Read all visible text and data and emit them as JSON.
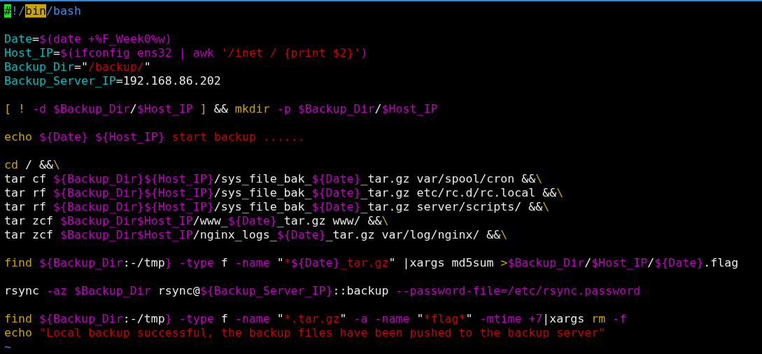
{
  "editor": {
    "blocks": [
      {
        "lines": [
          {
            "segments": [
              {
                "kind": "cursor",
                "text": "#"
              },
              {
                "kind": "path",
                "text": "!/"
              },
              {
                "kind": "search",
                "text": "bin"
              },
              {
                "kind": "path",
                "text": "/bash"
              }
            ]
          }
        ]
      },
      {
        "lines": [
          {
            "segments": [
              {
                "kind": "name",
                "text": "Date"
              },
              {
                "kind": "plain",
                "text": "="
              },
              {
                "kind": "variable",
                "text": "$(date +%F_Week0%w)"
              }
            ]
          },
          {
            "segments": [
              {
                "kind": "name",
                "text": "Host_IP"
              },
              {
                "kind": "plain",
                "text": "="
              },
              {
                "kind": "variable",
                "text": "$(ifconfig ens32 | awk "
              },
              {
                "kind": "string",
                "text": "'/inet / {print $2}'"
              },
              {
                "kind": "variable",
                "text": ")"
              }
            ]
          },
          {
            "segments": [
              {
                "kind": "name",
                "text": "Backup_Dir"
              },
              {
                "kind": "plain",
                "text": "=\""
              },
              {
                "kind": "string",
                "text": "/backup/"
              },
              {
                "kind": "plain",
                "text": "\""
              }
            ]
          },
          {
            "segments": [
              {
                "kind": "name",
                "text": "Backup_Server_IP"
              },
              {
                "kind": "plain",
                "text": "=192.168.86.202"
              }
            ]
          }
        ]
      },
      {
        "lines": [
          {
            "segments": [
              {
                "kind": "keyword",
                "text": "[ ! "
              },
              {
                "kind": "variable",
                "text": "-d $Backup_Dir"
              },
              {
                "kind": "plain",
                "text": "/"
              },
              {
                "kind": "variable",
                "text": "$Host_IP"
              },
              {
                "kind": "keyword",
                "text": " ]"
              },
              {
                "kind": "plain",
                "text": " && "
              },
              {
                "kind": "keyword",
                "text": "mkdir "
              },
              {
                "kind": "variable",
                "text": "-p $Backup_Dir"
              },
              {
                "kind": "plain",
                "text": "/"
              },
              {
                "kind": "variable",
                "text": "$Host_IP"
              }
            ]
          }
        ]
      },
      {
        "lines": [
          {
            "segments": [
              {
                "kind": "keyword",
                "text": "echo "
              },
              {
                "kind": "variable",
                "text": "${Date} ${Host_IP}"
              },
              {
                "kind": "string",
                "text": " start backup ......"
              }
            ]
          }
        ]
      },
      {
        "lines": [
          {
            "segments": [
              {
                "kind": "keyword",
                "text": "cd"
              },
              {
                "kind": "plain",
                "text": " / &&"
              },
              {
                "kind": "keyword",
                "text": "\\"
              }
            ]
          },
          {
            "segments": [
              {
                "kind": "plain",
                "text": "tar cf "
              },
              {
                "kind": "variable",
                "text": "${Backup_Dir}${Host_IP}"
              },
              {
                "kind": "plain",
                "text": "/sys_file_bak_"
              },
              {
                "kind": "variable",
                "text": "${Date}"
              },
              {
                "kind": "plain",
                "text": "_tar.gz var/spool/cron &&"
              },
              {
                "kind": "keyword",
                "text": "\\"
              }
            ]
          },
          {
            "segments": [
              {
                "kind": "plain",
                "text": "tar rf "
              },
              {
                "kind": "variable",
                "text": "${Backup_Dir}${Host_IP}"
              },
              {
                "kind": "plain",
                "text": "/sys_file_bak_"
              },
              {
                "kind": "variable",
                "text": "${Date}"
              },
              {
                "kind": "plain",
                "text": "_tar.gz etc/rc.d/rc.local &&"
              },
              {
                "kind": "keyword",
                "text": "\\"
              }
            ]
          },
          {
            "segments": [
              {
                "kind": "plain",
                "text": "tar rf "
              },
              {
                "kind": "variable",
                "text": "${Backup_Dir}${Host_IP}"
              },
              {
                "kind": "plain",
                "text": "/sys_file_bak_"
              },
              {
                "kind": "variable",
                "text": "${Date}"
              },
              {
                "kind": "plain",
                "text": "_tar.gz server/scripts/ &&"
              },
              {
                "kind": "keyword",
                "text": "\\"
              }
            ]
          },
          {
            "segments": [
              {
                "kind": "plain",
                "text": "tar zcf "
              },
              {
                "kind": "variable",
                "text": "$Backup_Dir$Host_IP"
              },
              {
                "kind": "plain",
                "text": "/www_"
              },
              {
                "kind": "variable",
                "text": "${Date}"
              },
              {
                "kind": "plain",
                "text": "_tar.gz www/ &&"
              },
              {
                "kind": "keyword",
                "text": "\\"
              }
            ]
          },
          {
            "segments": [
              {
                "kind": "plain",
                "text": "tar zcf "
              },
              {
                "kind": "variable",
                "text": "$Backup_Dir$Host_IP"
              },
              {
                "kind": "plain",
                "text": "/nginx_logs_"
              },
              {
                "kind": "variable",
                "text": "${Date}"
              },
              {
                "kind": "plain",
                "text": "_tar.gz var/log/nginx/ &&"
              },
              {
                "kind": "keyword",
                "text": "\\"
              }
            ]
          }
        ]
      },
      {
        "lines": [
          {
            "segments": [
              {
                "kind": "keyword",
                "text": "find "
              },
              {
                "kind": "variable",
                "text": "${Backup_Dir"
              },
              {
                "kind": "plain",
                "text": ":-/tmp"
              },
              {
                "kind": "variable",
                "text": "} -type"
              },
              {
                "kind": "plain",
                "text": " f "
              },
              {
                "kind": "variable",
                "text": "-name"
              },
              {
                "kind": "plain",
                "text": " \""
              },
              {
                "kind": "string",
                "text": "*"
              },
              {
                "kind": "variable",
                "text": "${Date}"
              },
              {
                "kind": "string",
                "text": "_tar.gz"
              },
              {
                "kind": "plain",
                "text": "\" |xargs md5sum "
              },
              {
                "kind": "keyword",
                "text": ">"
              },
              {
                "kind": "variable",
                "text": "$Backup_Dir"
              },
              {
                "kind": "plain",
                "text": "/"
              },
              {
                "kind": "variable",
                "text": "$Host_IP"
              },
              {
                "kind": "plain",
                "text": "/"
              },
              {
                "kind": "variable",
                "text": "${Date}"
              },
              {
                "kind": "plain",
                "text": ".flag"
              }
            ]
          }
        ]
      },
      {
        "lines": [
          {
            "segments": [
              {
                "kind": "plain",
                "text": "rsync "
              },
              {
                "kind": "variable",
                "text": "-az $Backup_Dir"
              },
              {
                "kind": "plain",
                "text": " rsync@"
              },
              {
                "kind": "variable",
                "text": "${Backup_Server_IP}"
              },
              {
                "kind": "plain",
                "text": "::backup "
              },
              {
                "kind": "variable",
                "text": "--password-file=/etc/rsync.password"
              }
            ]
          }
        ]
      },
      {
        "lines": [
          {
            "segments": [
              {
                "kind": "keyword",
                "text": "find "
              },
              {
                "kind": "variable",
                "text": "${Backup_Dir"
              },
              {
                "kind": "plain",
                "text": ":-/tmp"
              },
              {
                "kind": "variable",
                "text": "} -type"
              },
              {
                "kind": "plain",
                "text": " f "
              },
              {
                "kind": "variable",
                "text": "-name"
              },
              {
                "kind": "plain",
                "text": " \""
              },
              {
                "kind": "string",
                "text": "*.tar.gz"
              },
              {
                "kind": "plain",
                "text": "\" "
              },
              {
                "kind": "variable",
                "text": "-a -name"
              },
              {
                "kind": "plain",
                "text": " \""
              },
              {
                "kind": "string",
                "text": "*flag*"
              },
              {
                "kind": "plain",
                "text": "\" "
              },
              {
                "kind": "variable",
                "text": "-mtime +7"
              },
              {
                "kind": "plain",
                "text": "|xargs "
              },
              {
                "kind": "keyword",
                "text": "rm "
              },
              {
                "kind": "variable",
                "text": "-f"
              }
            ]
          },
          {
            "segments": [
              {
                "kind": "keyword",
                "text": "echo "
              },
              {
                "kind": "string",
                "text": "\"Local backup successful, the backup files have been pushed to the backup server\""
              }
            ]
          }
        ]
      }
    ],
    "end_marker": "~"
  }
}
